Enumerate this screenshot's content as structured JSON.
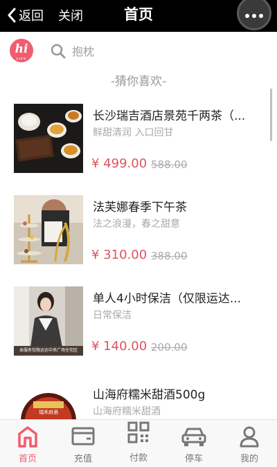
{
  "navbar": {
    "back_label": "返回",
    "close_label": "关闭",
    "title": "首页",
    "more_icon": "more-dots-icon"
  },
  "logo": {
    "text": "hi",
    "sub": "LIFE"
  },
  "search": {
    "placeholder": "抱枕",
    "icon": "search-icon"
  },
  "section": {
    "title": "-猜你喜欢-"
  },
  "products": [
    {
      "name": "长沙瑞吉酒店景苑千两茶（...",
      "desc": "鲜甜清润 入口回甘",
      "price": "¥ 499.00",
      "original_price": "588.00"
    },
    {
      "name": "法芙娜春季下午茶",
      "desc": "法之浪漫，春之甜意",
      "price": "¥ 310.00",
      "original_price": "388.00"
    },
    {
      "name": "单人4小时保洁（仅限运达...",
      "desc": "日常保洁",
      "price": "¥ 140.00",
      "original_price": "200.00",
      "image_caption": "本服务仅限运达中央广场住宅区"
    },
    {
      "name": "山海府糯米甜酒500g",
      "desc": "山海府糯米甜酒",
      "price": "",
      "original_price": "",
      "image_caption": "瑞禾府酒"
    }
  ],
  "tabs": [
    {
      "label": "首页",
      "icon": "home-icon",
      "active": true
    },
    {
      "label": "充值",
      "icon": "wallet-icon",
      "active": false
    },
    {
      "label": "付款",
      "icon": "qr-code-icon",
      "active": false
    },
    {
      "label": "停车",
      "icon": "car-icon",
      "active": false
    },
    {
      "label": "我的",
      "icon": "user-icon",
      "active": false
    }
  ],
  "colors": {
    "accent": "#f15c6e",
    "price": "#e0535c",
    "navbar": "#000000"
  }
}
